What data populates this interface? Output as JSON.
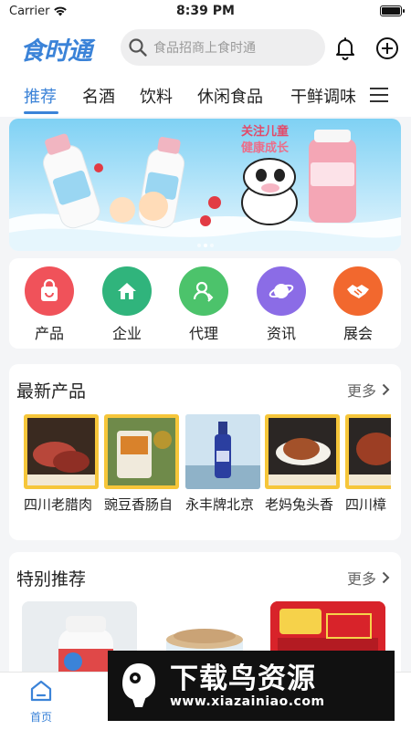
{
  "status": {
    "carrier": "Carrier",
    "time": "8:39 PM"
  },
  "header": {
    "logo": "食时通",
    "search_placeholder": "食品招商上食时通",
    "icons": [
      "bell-icon",
      "plus-circle-icon"
    ]
  },
  "tabs": [
    {
      "label": "推荐",
      "active": true
    },
    {
      "label": "名酒"
    },
    {
      "label": "饮料"
    },
    {
      "label": "休闲食品"
    },
    {
      "label": "干鲜调味"
    }
  ],
  "banner": {
    "slogan_line1": "关注儿童",
    "slogan_line2": "健康成长",
    "slides": 3,
    "active_slide": 2
  },
  "categories": [
    {
      "label": "产品",
      "icon": "shopping-bag-icon",
      "color": "#f0525a"
    },
    {
      "label": "企业",
      "icon": "home-icon",
      "color": "#30b47c"
    },
    {
      "label": "代理",
      "icon": "user-icon",
      "color": "#4cc36b"
    },
    {
      "label": "资讯",
      "icon": "planet-icon",
      "color": "#8b6ce6"
    },
    {
      "label": "展会",
      "icon": "handshake-icon",
      "color": "#f2682e"
    }
  ],
  "latest_products": {
    "title": "最新产品",
    "more": "更多",
    "items": [
      {
        "name": "四川老腊肉"
      },
      {
        "name": "豌豆香肠自"
      },
      {
        "name": "永丰牌北京"
      },
      {
        "name": "老妈兔头香"
      },
      {
        "name": "四川樟"
      }
    ]
  },
  "special": {
    "title": "特别推荐",
    "more": "更多"
  },
  "tabbar": {
    "home_label": "首页"
  },
  "watermark": {
    "title": "下载鸟资源",
    "url": "www.xiazainiao.com"
  }
}
